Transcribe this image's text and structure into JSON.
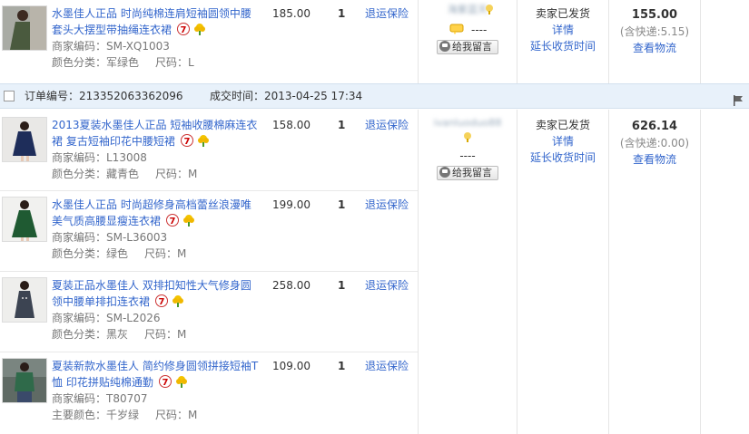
{
  "order1": {
    "items": [
      {
        "title": "水墨佳人正品 时尚纯棉连肩短袖圆领中腰套头大摆型带抽绳连衣裙",
        "code": "商家编码：SM-XQ1003",
        "color": "颜色分类：军绿色",
        "size": "尺码：L",
        "price": "185.00",
        "qty": "1",
        "insurance": "退运保险"
      }
    ],
    "seller": {
      "name": "海紫蓝天",
      "dash": "----",
      "msg_btn": "给我留言"
    },
    "status": {
      "state": "卖家已发货",
      "detail": "详情",
      "extend": "延长收货时间"
    },
    "amount": {
      "total": "155.00",
      "shipping": "(含快递:5.15)",
      "logistics": "查看物流"
    }
  },
  "order_header": {
    "order_no": "订单编号：213352063362096",
    "order_time": "成交时间：2013-04-25 17:34"
  },
  "order2": {
    "items": [
      {
        "title": "2013夏装水墨佳人正品 短袖收腰棉麻连衣裙 复古短袖印花中腰短裙",
        "code": "商家编码：L13008",
        "color": "颜色分类：藏青色",
        "size": "尺码：M",
        "price": "158.00",
        "qty": "1",
        "insurance": "退运保险"
      },
      {
        "title": "水墨佳人正品 时尚超修身高档蕾丝浪漫唯美气质高腰显瘦连衣裙",
        "code": "商家编码：SM-L36003",
        "color": "颜色分类：绿色",
        "size": "尺码：M",
        "price": "199.00",
        "qty": "1",
        "insurance": "退运保险"
      },
      {
        "title": "夏装正品水墨佳人 双排扣知性大气修身圆领中腰单排扣连衣裙",
        "code": "商家编码：SM-L2026",
        "color": "颜色分类：黑灰",
        "size": "尺码：M",
        "price": "258.00",
        "qty": "1",
        "insurance": "退运保险"
      },
      {
        "title": "夏装新款水墨佳人 简约修身圆领拼接短袖T恤 印花拼贴纯棉通勤",
        "code": "商家编码：T80707",
        "color": "主要颜色：千岁绿",
        "size": "尺码：M",
        "price": "109.00",
        "qty": "1",
        "insurance": "退运保险"
      }
    ],
    "seller": {
      "name": "ivanluoduo88",
      "dash": "----",
      "msg_btn": "给我留言"
    },
    "status": {
      "state": "卖家已发货",
      "detail": "详情",
      "extend": "延长收货时间"
    },
    "amount": {
      "total": "626.14",
      "shipping": "(含快递:0.00)",
      "logistics": "查看物流"
    }
  },
  "colors": {
    "link": "#3366cc",
    "header_bg": "#e8f1fa",
    "border": "#e5e5e5"
  },
  "icons": [
    "tmall-7-icon",
    "flower-badge-icon",
    "checkbox-icon",
    "flag-icon",
    "message-icon",
    "bubble-icon"
  ]
}
